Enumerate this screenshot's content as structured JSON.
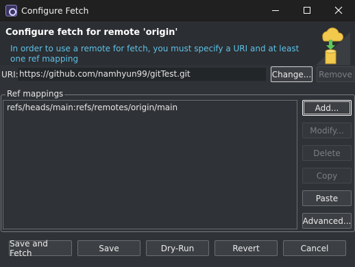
{
  "window": {
    "title": "Configure Fetch",
    "controls": {
      "minimize": "minimize",
      "maximize": "maximize",
      "close": "close"
    }
  },
  "header": {
    "title": "Configure fetch for remote 'origin'",
    "message": "In order to use a remote for fetch, you must specify a URI and at least one ref mapping",
    "icon": "fetch-cloud-database-icon"
  },
  "uri": {
    "label": "URI:",
    "value": "https://github.com/namhyun99/gitTest.git",
    "change_label": "Change...",
    "remove_label": "Remove"
  },
  "ref_mappings": {
    "group_label": "Ref mappings",
    "items": [
      "refs/heads/main:refs/remotes/origin/main"
    ],
    "buttons": {
      "add": "Add...",
      "modify": "Modify...",
      "delete": "Delete",
      "copy": "Copy",
      "paste": "Paste",
      "advanced": "Advanced..."
    }
  },
  "footer": {
    "save_fetch": "Save and Fetch",
    "save": "Save",
    "dry_run": "Dry-Run",
    "revert": "Revert",
    "cancel": "Cancel"
  },
  "colors": {
    "background": "#2f3236",
    "titlebar": "#202020",
    "message": "#5ec2e8",
    "cloud": "#f2c94c",
    "arrow": "#5cc85a"
  }
}
